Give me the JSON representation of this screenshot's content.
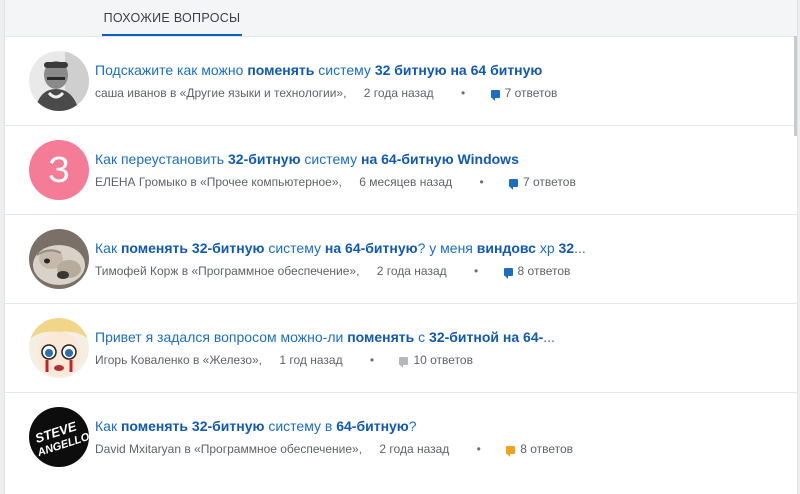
{
  "colors": {
    "accent": "#1a6ec4",
    "bold_link": "#1059b2",
    "tab_underline": "#0d5fc2",
    "avatar_pink": "#f47c97"
  },
  "header": {
    "tab_label": "ПОХОЖИЕ ВОПРОСЫ"
  },
  "questions": [
    {
      "title_parts": [
        {
          "text": "Подскажите как можно ",
          "bold": false
        },
        {
          "text": "поменять",
          "bold": true
        },
        {
          "text": " систему ",
          "bold": false
        },
        {
          "text": "32 битную на 64 битную",
          "bold": true
        }
      ],
      "author": "саша иванов",
      "in_word": " в ",
      "category": "«Другие языки и технологии»,",
      "time": "2 года назад",
      "answers": "7 ответов",
      "answers_color": "blue",
      "avatar": {
        "type": "image",
        "name": "person-photo-avatar"
      }
    },
    {
      "title_parts": [
        {
          "text": "Как переустановить ",
          "bold": false
        },
        {
          "text": "32-битную",
          "bold": true
        },
        {
          "text": " систему ",
          "bold": false
        },
        {
          "text": "на 64-битную Windows",
          "bold": true
        }
      ],
      "author": "ЕЛЕНА Громыко",
      "in_word": " в ",
      "category": "«Прочее компьютерное»,",
      "time": "6 месяцев назад",
      "answers": "7 ответов",
      "answers_color": "blue",
      "avatar": {
        "type": "letter",
        "letter": "З",
        "name": "letter-avatar"
      }
    },
    {
      "title_parts": [
        {
          "text": "Как ",
          "bold": false
        },
        {
          "text": "поменять 32-битную",
          "bold": true
        },
        {
          "text": " систему ",
          "bold": false
        },
        {
          "text": "на 64-битную",
          "bold": true
        },
        {
          "text": "? у меня ",
          "bold": false
        },
        {
          "text": "виндовс",
          "bold": true
        },
        {
          "text": " хр ",
          "bold": false
        },
        {
          "text": "32",
          "bold": true
        },
        {
          "text": "...",
          "bold": false
        }
      ],
      "author": "Тимофей Корж",
      "in_word": " в ",
      "category": "«Программное обеспечение»,",
      "time": "2 года назад",
      "answers": "8 ответов",
      "answers_color": "blue",
      "avatar": {
        "type": "image",
        "name": "bulldog-photo-avatar"
      }
    },
    {
      "title_parts": [
        {
          "text": "Привет я задался вопросом можно-ли ",
          "bold": false
        },
        {
          "text": "поменять",
          "bold": true
        },
        {
          "text": " с ",
          "bold": false
        },
        {
          "text": "32-битной на 64-",
          "bold": true
        },
        {
          "text": "...",
          "bold": false
        }
      ],
      "author": "Игорь Коваленко",
      "in_word": " в ",
      "category": "«Железо»,",
      "time": "1 год назад",
      "answers": "10 ответов",
      "answers_color": "gray",
      "avatar": {
        "type": "image",
        "name": "anime-face-avatar"
      }
    },
    {
      "title_parts": [
        {
          "text": "Как ",
          "bold": false
        },
        {
          "text": "поменять 32-битную",
          "bold": true
        },
        {
          "text": " систему в ",
          "bold": false
        },
        {
          "text": "64-битную",
          "bold": true
        },
        {
          "text": "?",
          "bold": false
        }
      ],
      "author": "David Mxitaryan",
      "in_word": " в ",
      "category": "«Программное обеспечение»,",
      "time": "2 года назад",
      "answers": "8 ответов",
      "answers_color": "orange",
      "avatar": {
        "type": "logo",
        "name": "steve-angello-logo-avatar",
        "logo_text": "STEVE ANGELLO"
      }
    }
  ]
}
